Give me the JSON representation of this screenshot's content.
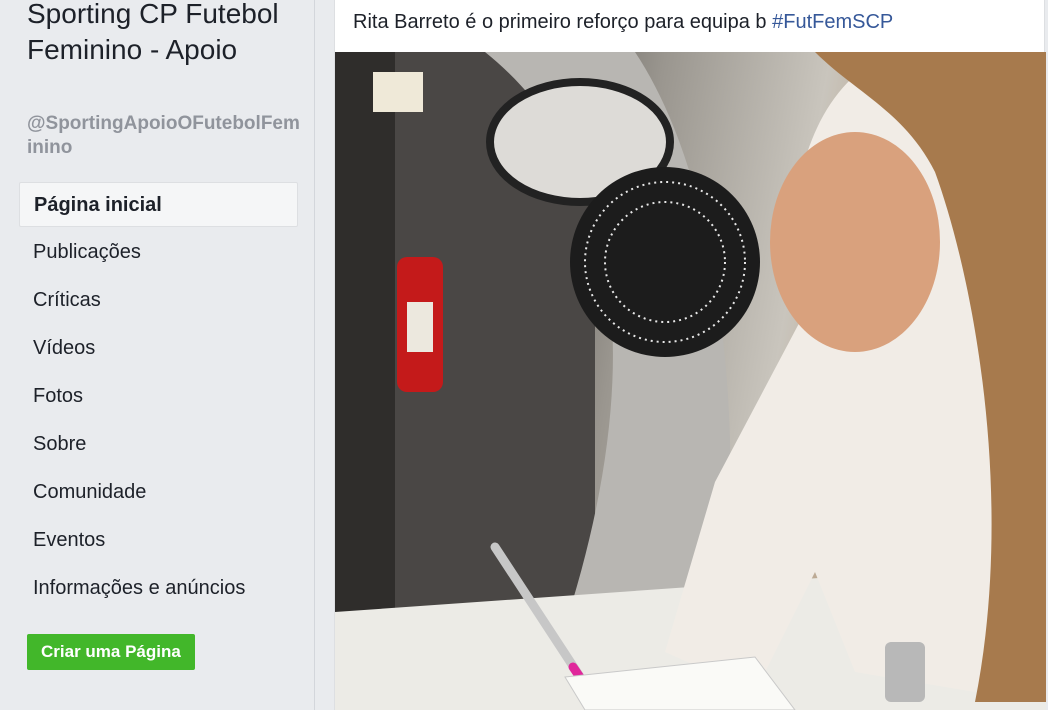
{
  "sidebar": {
    "page_name": "Sporting CP Futebol Feminino - Apoio",
    "page_handle": "@SportingApoioOFutebolFeminino",
    "nav_items": [
      {
        "label": "Página inicial",
        "active": true
      },
      {
        "label": "Publicações"
      },
      {
        "label": "Críticas"
      },
      {
        "label": "Vídeos"
      },
      {
        "label": "Fotos"
      },
      {
        "label": "Sobre"
      },
      {
        "label": "Comunidade"
      },
      {
        "label": "Eventos"
      },
      {
        "label": "Informações e anúncios"
      }
    ],
    "create_page_label": "Criar uma Página"
  },
  "post": {
    "text": "Rita Barreto é o primeiro reforço para equipa b ",
    "hashtag": "#FutFemSCP"
  },
  "colors": {
    "link": "#365899",
    "create_button": "#42b72a",
    "background": "#e9ebee"
  }
}
